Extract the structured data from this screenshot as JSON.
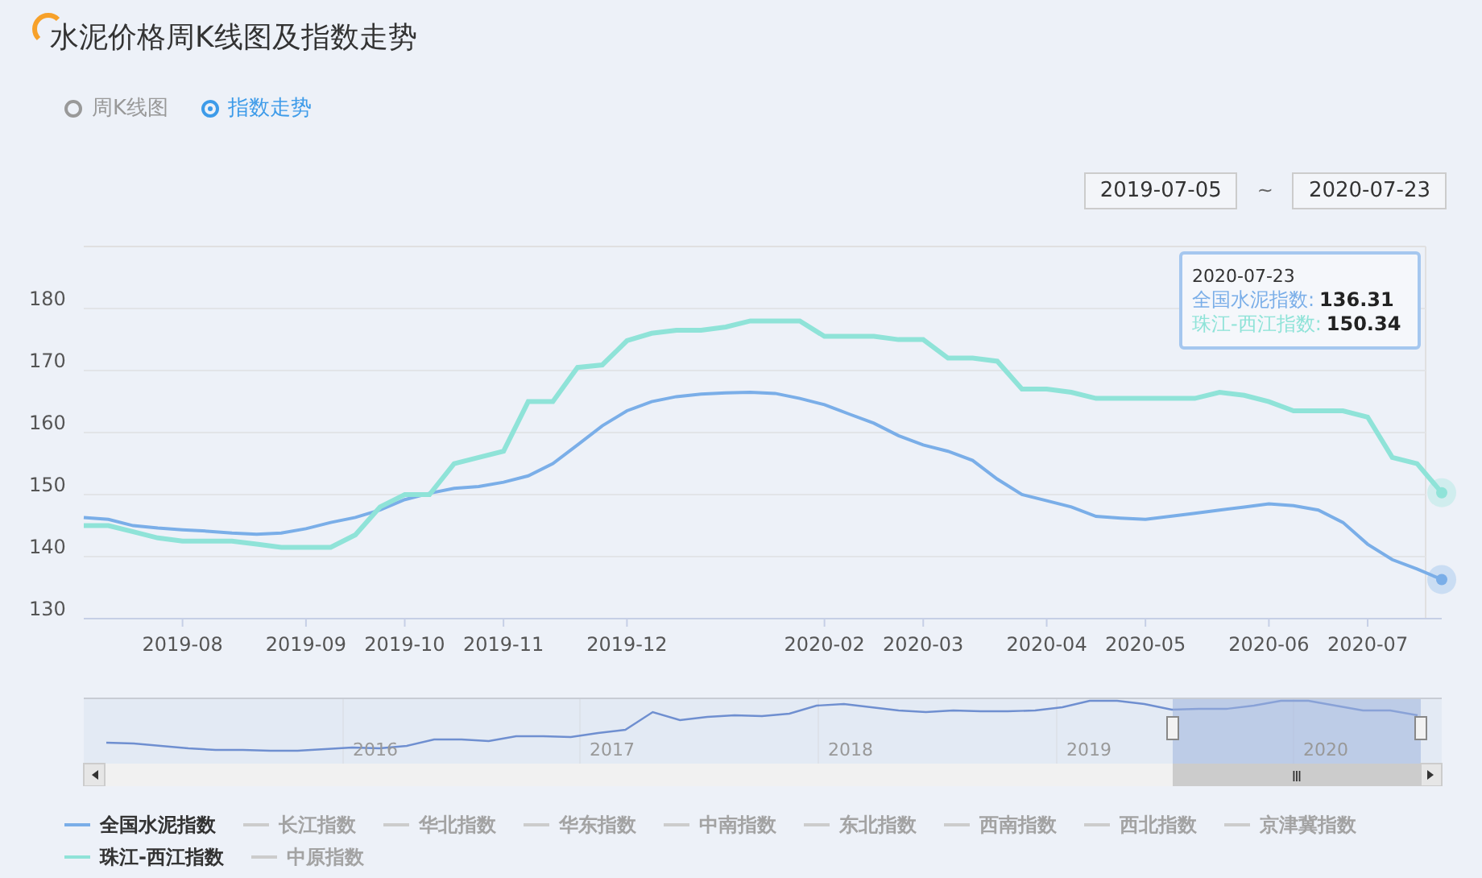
{
  "title": "水泥价格周K线图及指数走势",
  "view_options": [
    {
      "label": "周K线图",
      "selected": false
    },
    {
      "label": "指数走势",
      "selected": true
    }
  ],
  "date_range": {
    "start": "2019-07-05",
    "separator": "~",
    "end": "2020-07-23"
  },
  "chart": {
    "chart_data": {
      "type": "line",
      "categories": [
        null,
        null,
        null,
        null,
        "2019-08",
        null,
        null,
        null,
        null,
        "2019-09",
        null,
        null,
        null,
        "2019-10",
        null,
        null,
        null,
        "2019-11",
        null,
        null,
        null,
        null,
        "2019-12",
        null,
        null,
        null,
        null,
        null,
        null,
        null,
        "2020-02",
        null,
        null,
        null,
        "2020-03",
        null,
        null,
        null,
        null,
        "2020-04",
        null,
        null,
        null,
        "2020-05",
        null,
        null,
        null,
        null,
        "2020-06",
        null,
        null,
        null,
        "2020-07",
        null,
        null,
        null
      ],
      "grid": true,
      "series": [
        {
          "name": "全国水泥指数",
          "color": "#7aaee8",
          "values": [
            146.3,
            146,
            145,
            144.6,
            144.3,
            144.1,
            143.8,
            143.6,
            143.8,
            144.5,
            145.5,
            146.3,
            147.5,
            149.2,
            150.2,
            151,
            151.3,
            152,
            153,
            155,
            158,
            161.1,
            163.5,
            165,
            165.8,
            166.2,
            166.4,
            166.5,
            166.3,
            165.5,
            164.5,
            163,
            161.5,
            159.5,
            158,
            157,
            155.5,
            152.5,
            150,
            149,
            148,
            146.5,
            146.2,
            146,
            146.5,
            147,
            147.5,
            148,
            148.5,
            148.2,
            147.5,
            145.5,
            142,
            139.5,
            138,
            136.3
          ]
        },
        {
          "name": "珠江-西江指数",
          "color": "#8fe3d8",
          "values": [
            145,
            145,
            144,
            143,
            142.5,
            142.5,
            142.5,
            142,
            141.5,
            141.5,
            141.5,
            143.5,
            148,
            150,
            150,
            155,
            156,
            157,
            165,
            165,
            170.5,
            170.9,
            174.8,
            176,
            176.5,
            176.5,
            177,
            178,
            178,
            178,
            175.5,
            175.5,
            175.5,
            175,
            175,
            172,
            172,
            171.5,
            167,
            167,
            166.5,
            165.5,
            165.5,
            165.5,
            165.5,
            165.5,
            166.5,
            166,
            165,
            163.5,
            163.5,
            163.5,
            162.5,
            156,
            155,
            150.3
          ]
        }
      ],
      "ylim": [
        130,
        190
      ],
      "yticks": [
        130,
        140,
        150,
        160,
        170,
        180
      ]
    },
    "tooltip": {
      "date": "2020-07-23",
      "rows": [
        {
          "label": "全国水泥指数:",
          "value": "136.31"
        },
        {
          "label": "珠江-西江指数:",
          "value": "150.34"
        }
      ]
    }
  },
  "overview": {
    "years": [
      "2016",
      "2017",
      "2018",
      "2019",
      "2020"
    ],
    "scroll_grip": "Ⅲ"
  },
  "legend": [
    {
      "kind": "series",
      "selected": true
    },
    {
      "label": "长江指数",
      "selected": false
    },
    {
      "label": "华北指数",
      "selected": false
    },
    {
      "label": "华东指数",
      "selected": false
    },
    {
      "label": "中南指数",
      "selected": false
    },
    {
      "label": "东北指数",
      "selected": false
    },
    {
      "label": "西南指数",
      "selected": false
    },
    {
      "label": "西北指数",
      "selected": false
    },
    {
      "label": "京津冀指数",
      "selected": false
    },
    {
      "kind": "series",
      "selected": true
    },
    {
      "label": "中原指数",
      "selected": false
    }
  ]
}
